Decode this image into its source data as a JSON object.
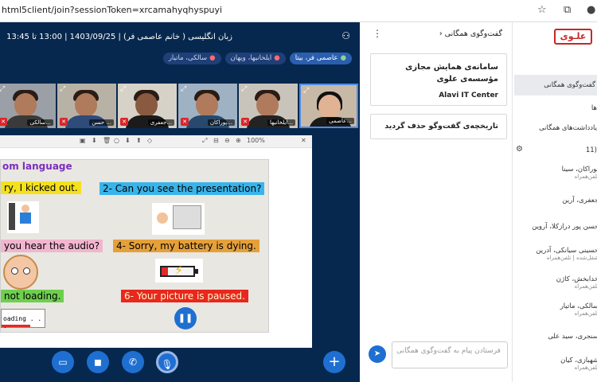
{
  "browser": {
    "url": "html5client/join?sessionToken=xrcamahyqhyspuyi"
  },
  "meeting": {
    "title": "زبان انگلیسی ( خانم عاصمی فر) | 1403/09/25 | 13:00 تا 13:45",
    "talkers": [
      {
        "name": "عاصمی فر، بیتا",
        "active": true
      },
      {
        "name": "ایلخانیها، ویهان",
        "active": false
      },
      {
        "name": "سالکی، ماتیار",
        "active": false
      }
    ],
    "tiles": [
      {
        "name": "سالکی...",
        "muted": true,
        "shirt": "#3a3a3a"
      },
      {
        "name": "حسن ...",
        "muted": true,
        "shirt": "#2f4b7a"
      },
      {
        "name": "جعفری...",
        "muted": true,
        "shirt": "#1b1b1b"
      },
      {
        "name": "پوراکان...",
        "muted": true,
        "shirt": "#27496d"
      },
      {
        "name": "ایلخانیها...",
        "muted": true,
        "shirt": "#232323"
      },
      {
        "name": "عاصمی...",
        "muted": false,
        "shirt": "#1a1a1a"
      }
    ],
    "viewer": {
      "zoom": "100%"
    },
    "slide": {
      "title": "om language",
      "items": [
        {
          "text": "ry, I kicked out.",
          "bg": "#f4e11d"
        },
        {
          "text": "2- Can you see the presentation?",
          "bg": "#38b4ea"
        },
        {
          "text": " you hear the audio?",
          "bg": "#f2b5cf"
        },
        {
          "text": "4- Sorry, my battery is dying.",
          "bg": "#e5a03a"
        },
        {
          "text": "not loading.",
          "bg": "#6ecf4e"
        },
        {
          "text": "6- Your picture is paused.",
          "bg": "#e8271f"
        }
      ],
      "loading_text": "oading . . ."
    }
  },
  "chat": {
    "header": "گفت‌وگوی همگانی",
    "welcome_line1": "سامانه‌ی همایش مجازی",
    "welcome_line2": "مؤسسه‌ی علوی",
    "welcome_brand": "Alavi IT Center",
    "cleared": "تاریخچه‌ی گفت‌وگو حذف گردید",
    "input_placeholder": "فرستادن پیام به گفت‌وگوی همگانی"
  },
  "sidebar": {
    "logo": "علـوی",
    "items": [
      "گفت‌وگوی همگانی",
      "ها",
      "یادداشت‌های همگانی",
      "(11"
    ],
    "participants": [
      {
        "name": "پوراکان، سینا",
        "role": "تلفن‌همراه"
      },
      {
        "name": "جعفری، آرین",
        "role": ""
      },
      {
        "name": "حسن پور درازکلا، آروین",
        "role": ""
      },
      {
        "name": "حسینی سیانکی، آدرین",
        "role": "شقل‌شده | تلفن‌همراه"
      },
      {
        "name": "خدابخش، کاژن",
        "role": "تلفن‌همراه"
      },
      {
        "name": "سالکی، ماتیار",
        "role": "تلفن‌همراه"
      },
      {
        "name": "سنجری، سید علی",
        "role": ""
      },
      {
        "name": "شهبازی، کیان",
        "role": "تلفن‌همراه"
      }
    ]
  },
  "colors": {
    "meeting_bg": "#06284e",
    "accent": "#1f6fd1",
    "mute": "#d9262c"
  }
}
